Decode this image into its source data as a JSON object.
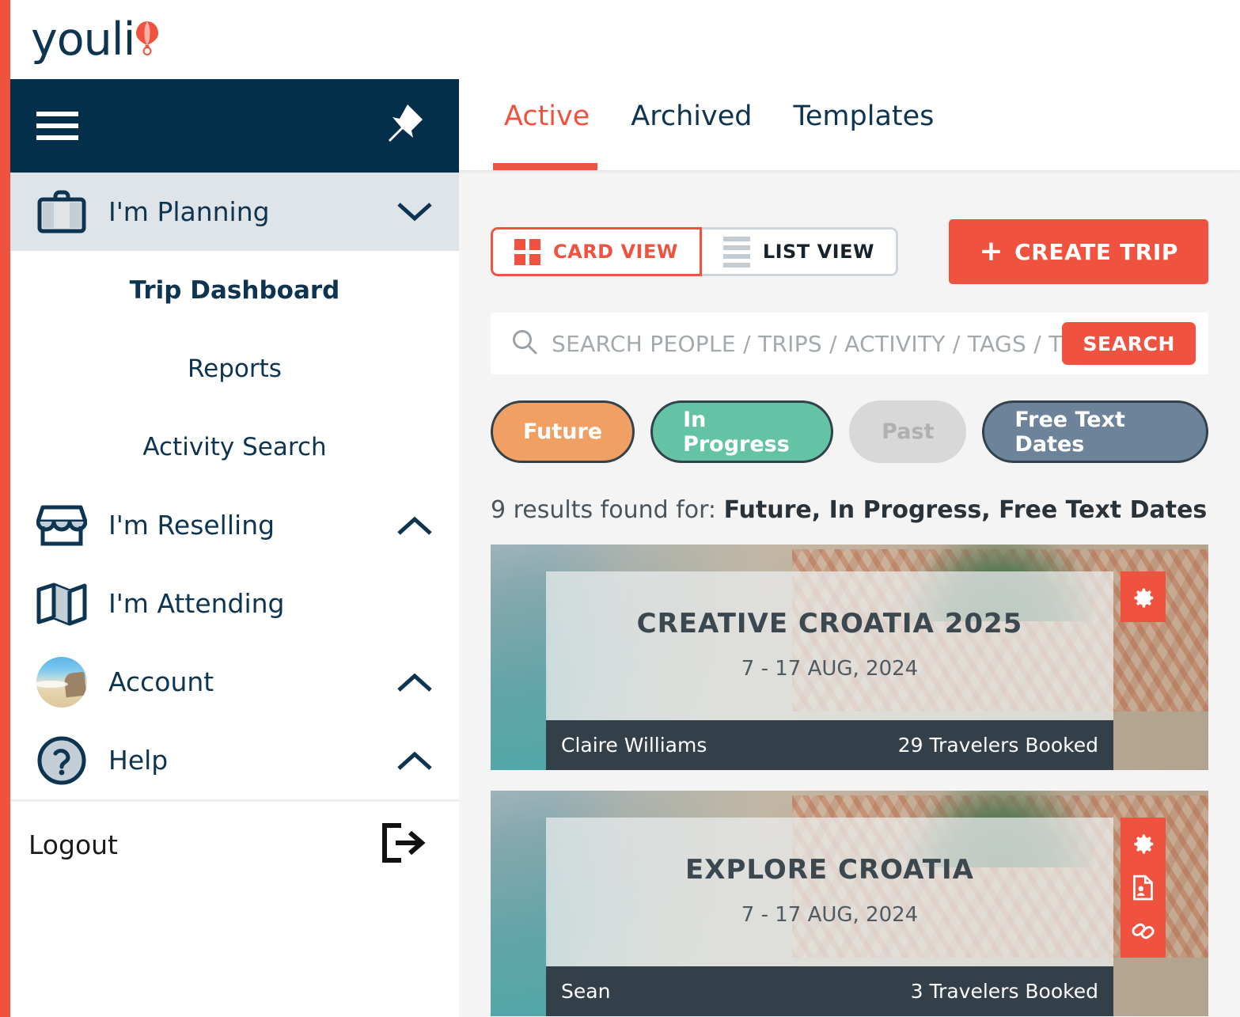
{
  "brand": {
    "name": "youli",
    "logo_icon": "hot-air-balloon-icon",
    "accent_color": "#ef5340",
    "navy_color": "#042f4b"
  },
  "sidebar": {
    "menu_icon": "hamburger-icon",
    "pin_icon": "pin-icon",
    "groups": [
      {
        "label": "I'm Planning",
        "icon": "suitcase-icon",
        "chevron": "chevron-down-icon",
        "expanded": true,
        "active": true,
        "children": [
          {
            "label": "Trip Dashboard",
            "selected": true
          },
          {
            "label": "Reports",
            "selected": false
          },
          {
            "label": "Activity Search",
            "selected": false
          }
        ]
      },
      {
        "label": "I'm Reselling",
        "icon": "storefront-icon",
        "chevron": "chevron-up-icon",
        "expanded": false,
        "active": false,
        "children": []
      },
      {
        "label": "I'm Attending",
        "icon": "map-icon",
        "chevron": "",
        "expanded": false,
        "active": false,
        "children": []
      },
      {
        "label": "Account",
        "icon": "avatar-icon",
        "chevron": "chevron-up-icon",
        "expanded": false,
        "active": false,
        "children": []
      },
      {
        "label": "Help",
        "icon": "question-mark-circle-icon",
        "chevron": "chevron-up-icon",
        "expanded": false,
        "active": false,
        "children": []
      }
    ],
    "logout": {
      "label": "Logout",
      "icon": "logout-arrow-icon"
    }
  },
  "tabs": [
    {
      "label": "Active",
      "active": true
    },
    {
      "label": "Archived",
      "active": false
    },
    {
      "label": "Templates",
      "active": false
    }
  ],
  "toolbar": {
    "card_view_label": "CARD VIEW",
    "card_view_icon": "grid-icon",
    "card_view_selected": true,
    "list_view_label": "LIST VIEW",
    "list_view_icon": "list-icon",
    "list_view_selected": false,
    "create_trip_label": "CREATE TRIP",
    "create_trip_plus": "+"
  },
  "search": {
    "icon": "search-icon",
    "placeholder": "SEARCH PEOPLE / TRIPS / ACTIVITY / TAGS / TO",
    "value": "",
    "button_label": "SEARCH"
  },
  "filters": [
    {
      "label": "Future",
      "color": "#f0a063",
      "active": true
    },
    {
      "label": "In Progress",
      "color": "#63c3a4",
      "active": true
    },
    {
      "label": "Past",
      "color": "#d8d8d8",
      "active": false
    },
    {
      "label": "Free Text Dates",
      "color": "#6d8399",
      "active": true
    }
  ],
  "results": {
    "prefix": "9 results found for: ",
    "terms": "Future, In Progress, Free Text Dates"
  },
  "trips": [
    {
      "title": "CREATIVE CROATIA 2025",
      "dates": "7 - 17 AUG, 2024",
      "organizer": "Claire Williams",
      "travelers": "29 Travelers Booked",
      "actions": [
        "gear-icon"
      ]
    },
    {
      "title": "EXPLORE CROATIA",
      "dates": "7 - 17 AUG, 2024",
      "organizer": "Sean",
      "travelers": "3 Travelers Booked",
      "actions": [
        "gear-icon",
        "document-person-icon",
        "link-icon"
      ]
    }
  ]
}
